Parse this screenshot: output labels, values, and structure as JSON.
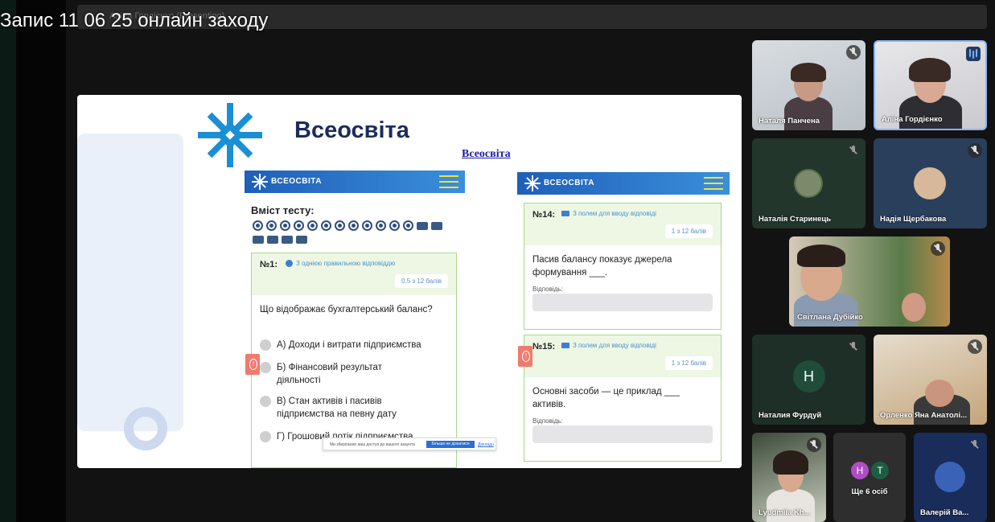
{
  "video_title": "Запис 11 06 25 онлайн заходу",
  "meeting_bar": {
    "name": "Аліна Гордієнко (Presenting)"
  },
  "brand": {
    "name": "Всеосвіта",
    "link": "Всеосвіта",
    "header_name": "ВСЕОСВІТА"
  },
  "left_panel": {
    "content_title": "Вміст тесту:",
    "question": {
      "number": "№1:",
      "type": "З однією правильною відповіддю",
      "points": "0.5 з 12 балів",
      "text": "Що відображає бухгалтерський баланс?",
      "options": [
        "А) Доходи і витрати підприємства",
        "Б) Фінансовий результат діяльності",
        "В) Стан активів і пасивів підприємства на певну дату",
        "Г) Грошовий потік підприємства"
      ]
    }
  },
  "right_panel": {
    "questions": [
      {
        "number": "№14:",
        "type": "З полем для вводу відповіді",
        "points": "1 з 12 балів",
        "text": "Пасив балансу показує джерела формування ___.",
        "answer_label": "Відповідь:"
      },
      {
        "number": "№15:",
        "type": "З полем для вводу відповіді",
        "points": "1 з 12 балів",
        "text": "Основні засоби — це приклад ___ активів.",
        "answer_label": "Відповідь:"
      }
    ]
  },
  "cookie_banner": {
    "text": "Ми зберігаємо ваш доступ до вашого акаунта",
    "button": "Більше не дізнатися",
    "link": "Докладн"
  },
  "participants": [
    {
      "name": "Наталя Панчена",
      "mic": "muted"
    },
    {
      "name": "Аліна Гордієнко",
      "mic": "speaking"
    },
    {
      "name": "Наталія Старинець",
      "mic": "muted"
    },
    {
      "name": "Надія Щербакова",
      "mic": "muted"
    },
    {
      "name": "Світлана Дубійко",
      "mic": "muted"
    },
    {
      "name": "Наталия Фурдуй",
      "initial": "Н",
      "mic": "muted"
    },
    {
      "name": "Орленко Яна Анатолі...",
      "mic": "muted"
    },
    {
      "name": "Lyudmila Kh...",
      "mic": "muted"
    },
    {
      "name": "Ще 6 осіб",
      "initials": [
        "Н",
        "Т"
      ]
    },
    {
      "name": "Валерій Ва...",
      "mic": "muted"
    }
  ],
  "colors": {
    "accent_blue": "#1f5fb8",
    "card_green": "#a9d88c",
    "hamburger_yellow": "#f4e23a"
  }
}
